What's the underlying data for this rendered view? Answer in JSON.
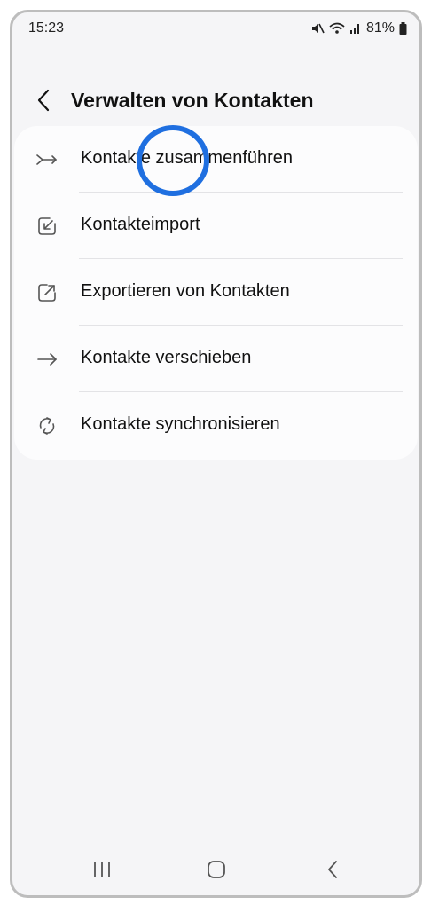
{
  "status_bar": {
    "time": "15:23",
    "battery": "81%",
    "icons": [
      "mute-icon",
      "wifi-icon",
      "signal-icon",
      "battery-icon"
    ]
  },
  "header": {
    "back_icon": "chevron-left-icon",
    "title": "Verwalten von Kontakten"
  },
  "menu": {
    "items": [
      {
        "label": "Kontakte zusammenführen",
        "icon": "merge-icon"
      },
      {
        "label": "Kontakteimport",
        "icon": "import-icon"
      },
      {
        "label": "Exportieren von Kontakten",
        "icon": "export-icon"
      },
      {
        "label": "Kontakte verschieben",
        "icon": "arrow-right-icon"
      },
      {
        "label": "Kontakte synchronisieren",
        "icon": "sync-icon"
      }
    ]
  },
  "nav_bar": {
    "icons": [
      "recent-apps-icon",
      "home-icon",
      "back-icon"
    ]
  },
  "colors": {
    "highlight": "#1f6fe0",
    "background": "#f5f5f7",
    "card": "#fcfcfd"
  }
}
